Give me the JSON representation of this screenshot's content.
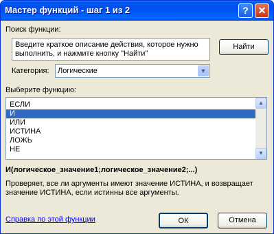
{
  "window": {
    "title": "Мастер функций - шаг 1 из 2",
    "help_symbol": "?",
    "close_symbol": "✕"
  },
  "search": {
    "label": "Поиск функции:",
    "description": "Введите краткое описание действия, которое нужно выполнить, и нажмите кнопку \"Найти\"",
    "find_button": "Найти"
  },
  "category": {
    "label": "Категория:",
    "value": "Логические"
  },
  "functions": {
    "label": "Выберите функцию:",
    "items": [
      "ЕСЛИ",
      "И",
      "ИЛИ",
      "ИСТИНА",
      "ЛОЖЬ",
      "НЕ"
    ],
    "selected_index": 1
  },
  "details": {
    "syntax": "И(логическое_значение1;логическое_значение2;...)",
    "description": "Проверяет, все ли аргументы имеют значение ИСТИНА, и возвращает значение ИСТИНА, если истинны все аргументы."
  },
  "footer": {
    "help_link": "Справка по этой функции",
    "ok_button": "ОК",
    "cancel_button": "Отмена"
  },
  "colors": {
    "title_bar": "#0054e3",
    "dialog_bg": "#ece9d8",
    "selection": "#316ac5",
    "link": "#0000ff"
  }
}
